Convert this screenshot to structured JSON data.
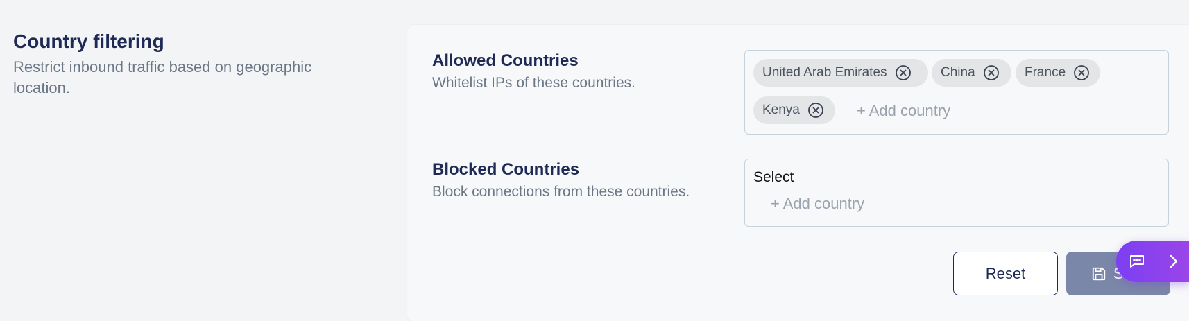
{
  "section": {
    "title": "Country filtering",
    "description": "Restrict inbound traffic based on geographic location."
  },
  "allowed": {
    "title": "Allowed Countries",
    "description": "Whitelist IPs of these countries.",
    "chips": [
      "United Arab Emirates",
      "China",
      "France",
      "Kenya"
    ],
    "add_label": "+ Add country"
  },
  "blocked": {
    "title": "Blocked Countries",
    "description": "Block connections from these countries.",
    "select_label": "Select",
    "add_label": "+ Add country"
  },
  "actions": {
    "reset_label": "Reset",
    "save_label": "Save"
  },
  "icons": {
    "chip_remove": "close-circle-icon",
    "save": "floppy-disk-icon",
    "chat": "chat-bubble-icon",
    "expand": "chevron-right-icon"
  },
  "colors": {
    "heading": "#1e2a55",
    "muted_text": "#6b7785",
    "chip_bg": "#e4e5e7",
    "save_button_bg": "#7b87a8",
    "widget_gradient_start": "#7b3ff2",
    "widget_gradient_end": "#9a45e8"
  }
}
